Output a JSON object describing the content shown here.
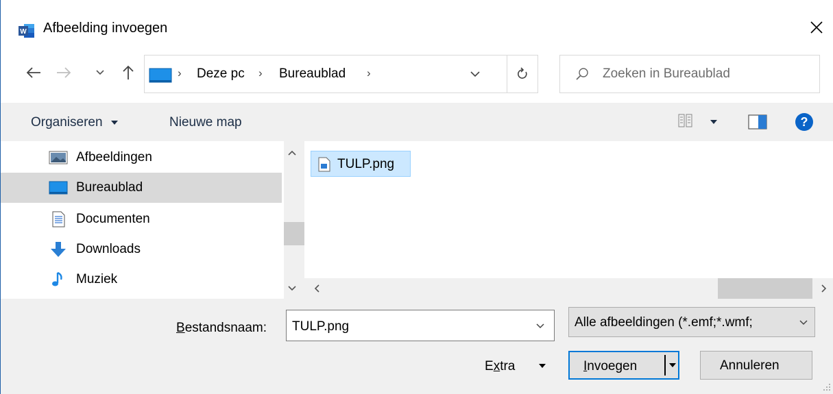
{
  "window": {
    "title": "Afbeelding invoegen",
    "app_icon": "word-icon",
    "close_icon": "close-icon"
  },
  "nav": {
    "back_icon": "arrow-left-icon",
    "forward_icon": "arrow-right-icon",
    "recent_icon": "chevron-down-icon",
    "up_icon": "arrow-up-icon",
    "breadcrumbs": [
      "Deze pc",
      "Bureaublad"
    ],
    "search_placeholder": "Zoeken in Bureaublad"
  },
  "toolbar": {
    "organize_label": "Organiseren",
    "new_folder_label": "Nieuwe map",
    "view_icon": "view-options-icon",
    "preview_icon": "preview-pane-icon",
    "help_icon": "help-icon"
  },
  "nav_pane": {
    "items": [
      {
        "label": "Afbeeldingen",
        "icon": "pictures-icon",
        "selected": false
      },
      {
        "label": "Bureaublad",
        "icon": "desktop-icon",
        "selected": true
      },
      {
        "label": "Documenten",
        "icon": "documents-icon",
        "selected": false
      },
      {
        "label": "Downloads",
        "icon": "downloads-icon",
        "selected": false
      },
      {
        "label": "Muziek",
        "icon": "music-icon",
        "selected": false
      }
    ]
  },
  "files": [
    {
      "name": "TULP.png",
      "icon": "image-file-icon",
      "selected": true
    }
  ],
  "bottom": {
    "filename_label_underline": "B",
    "filename_label_rest": "estandsnaam:",
    "filename_value": "TULP.png",
    "filter_value": "Alle afbeeldingen (*.emf;*.wmf;",
    "extra_label_a": "E",
    "extra_label_u": "x",
    "extra_label_b": "tra",
    "insert_label_underline": "I",
    "insert_label_rest": "nvoegen",
    "cancel_label": "Annuleren"
  },
  "colors": {
    "accent": "#0078d7",
    "selection": "#cce8ff",
    "toolbar_bg": "#f0f0f0",
    "word_blue": "#2b579a"
  }
}
